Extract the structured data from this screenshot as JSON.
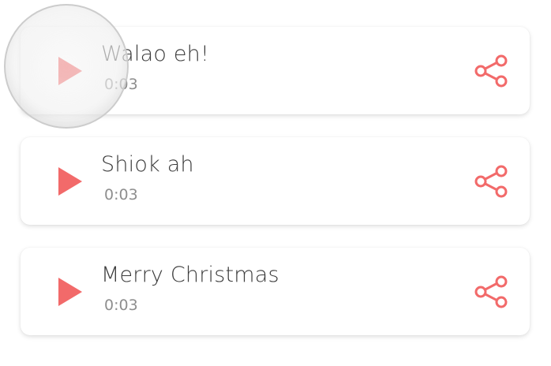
{
  "colors": {
    "accent": "#f26a6a",
    "title_text": "#3a3a3a",
    "duration_text": "#8e8e8e",
    "card_bg": "#ffffff"
  },
  "icons": {
    "play": "play-icon",
    "share": "share-icon"
  },
  "sounds": [
    {
      "title": "Walao eh!",
      "duration": "0:03"
    },
    {
      "title": "Shiok ah",
      "duration": "0:03"
    },
    {
      "title": "Merry Christmas",
      "duration": "0:03"
    }
  ]
}
